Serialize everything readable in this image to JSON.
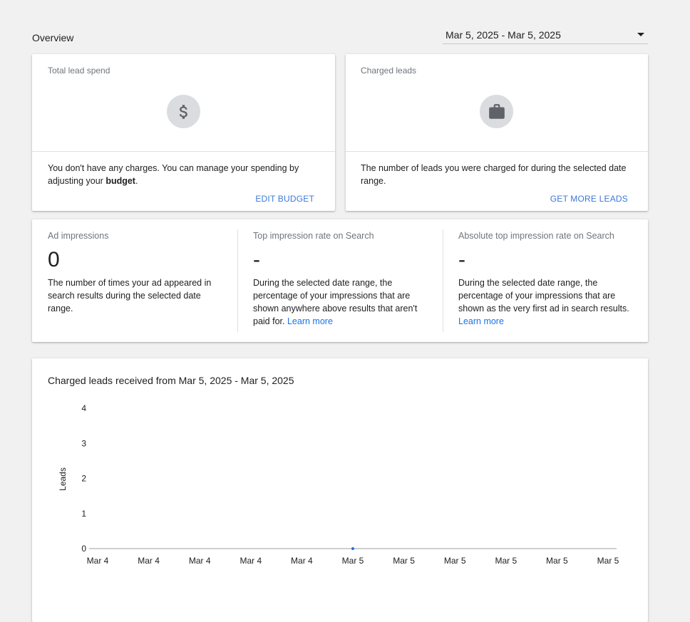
{
  "header": {
    "title": "Overview",
    "date_range": "Mar 5, 2025 - Mar 5, 2025"
  },
  "lead_spend_card": {
    "label": "Total lead spend",
    "icon": "dollar-icon",
    "text_before": "You don't have any charges. You can manage your spending by adjusting your ",
    "text_bold": "budget",
    "text_after": ".",
    "link_label": "EDIT BUDGET"
  },
  "charged_leads_card": {
    "label": "Charged leads",
    "icon": "briefcase-icon",
    "text": "The number of leads you were charged for during the selected date range.",
    "link_label": "GET MORE LEADS"
  },
  "metrics": [
    {
      "label": "Ad impressions",
      "value": "0",
      "description": "The number of times your ad appeared in search results during the selected date range.",
      "link": ""
    },
    {
      "label": "Top impression rate on Search",
      "value": "-",
      "description": "During the selected date range, the percentage of your impressions that are shown anywhere above results that aren't paid for.",
      "link": "Learn more"
    },
    {
      "label": "Absolute top impression rate on Search",
      "value": "-",
      "description": "During the selected date range, the percentage of your impressions that are shown as the very first ad in search results.",
      "link": "Learn more"
    }
  ],
  "chart_data": {
    "type": "line",
    "title": "Charged leads received from Mar 5, 2025 - Mar 5, 2025",
    "xlabel": "",
    "ylabel": "Leads",
    "categories": [
      "Mar 4",
      "Mar 4",
      "Mar 4",
      "Mar 4",
      "Mar 4",
      "Mar 5",
      "Mar 5",
      "Mar 5",
      "Mar 5",
      "Mar 5",
      "Mar 5"
    ],
    "yticks": [
      0,
      1,
      2,
      3,
      4
    ],
    "ylim": [
      0,
      4
    ],
    "series": [
      {
        "points": [
          {
            "x_index": 5,
            "y": 0
          }
        ]
      }
    ],
    "grid": false,
    "colors": {
      "axis": "#9aa0a6",
      "point": "#1a73e8"
    }
  }
}
